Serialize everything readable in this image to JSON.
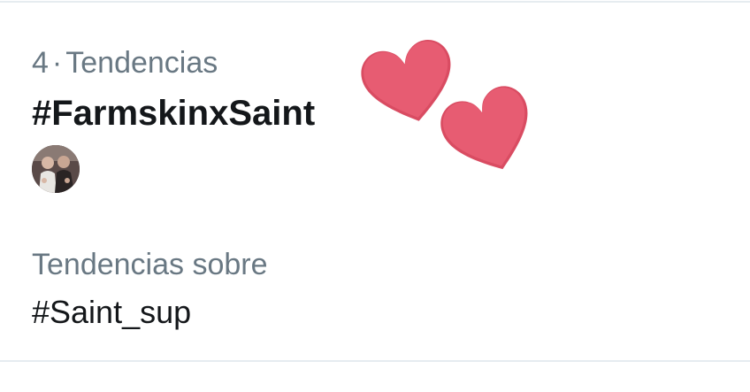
{
  "trend": {
    "rank": "4",
    "separator": "·",
    "category": "Tendencias",
    "title": "#FarmskinxSaint"
  },
  "related": {
    "label": "Tendencias sobre",
    "hashtag": "#Saint_sup"
  },
  "decorations": {
    "heart_color": "#e75c72",
    "heart_shade": "#d94c62"
  },
  "colors": {
    "meta_text": "#697883",
    "primary_text": "#14171a",
    "divider": "#e6ecf0"
  }
}
